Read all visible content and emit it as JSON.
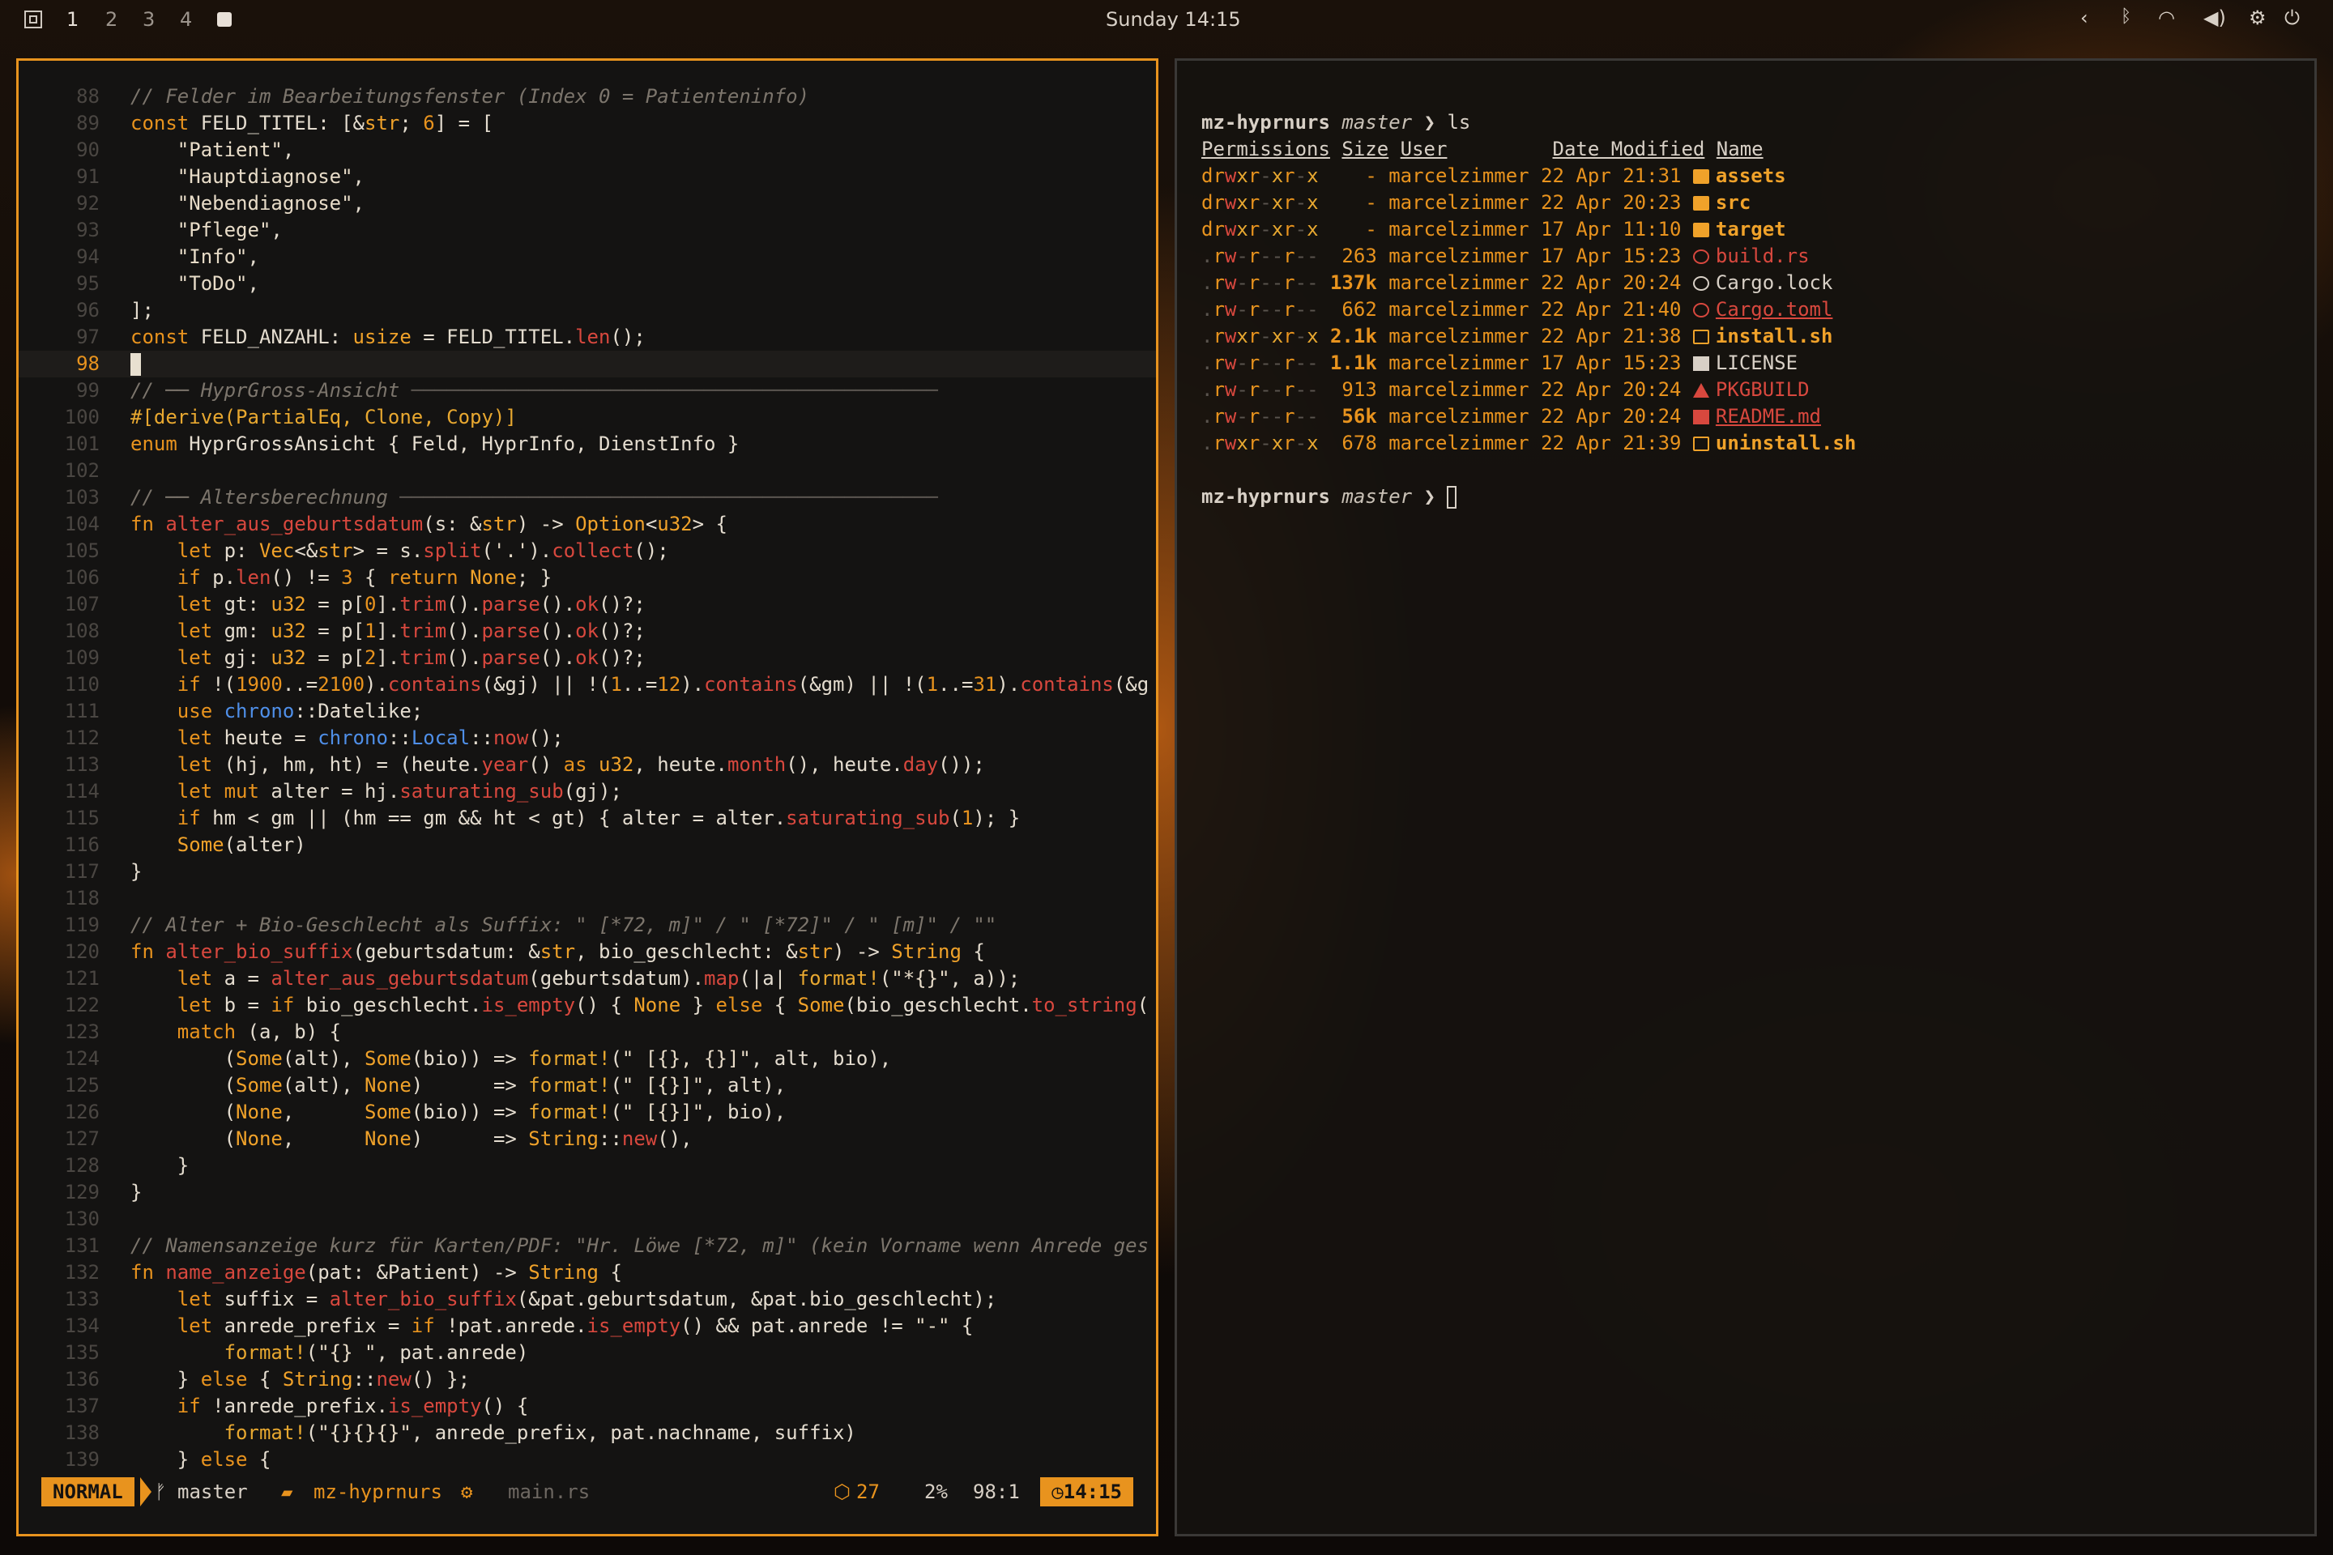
{
  "topbar": {
    "workspaces": [
      "1",
      "2",
      "3",
      "4"
    ],
    "active_workspace": "1",
    "clock": "Sunday 14:15",
    "tray_icons": [
      "chevron-left-icon",
      "bluetooth-icon",
      "wifi-icon",
      "volume-icon",
      "settings-icon",
      "power-icon"
    ]
  },
  "editor": {
    "lines": [
      {
        "n": "88",
        "t": "// Felder im Bearbeitungsfenster (Index 0 = Patienteninfo)"
      },
      {
        "n": "89",
        "t": "const FELD_TITEL: [&str; 6] = ["
      },
      {
        "n": "90",
        "t": "    \"Patient\","
      },
      {
        "n": "91",
        "t": "    \"Hauptdiagnose\","
      },
      {
        "n": "92",
        "t": "    \"Nebendiagnose\","
      },
      {
        "n": "93",
        "t": "    \"Pflege\","
      },
      {
        "n": "94",
        "t": "    \"Info\","
      },
      {
        "n": "95",
        "t": "    \"ToDo\","
      },
      {
        "n": "96",
        "t": "];"
      },
      {
        "n": "97",
        "t": "const FELD_ANZAHL: usize = FELD_TITEL.len();"
      },
      {
        "n": "98",
        "t": ""
      },
      {
        "n": "99",
        "t": "// ── HyprGross-Ansicht ─────────────────────────────────────────────"
      },
      {
        "n": "100",
        "t": "#[derive(PartialEq, Clone, Copy)]"
      },
      {
        "n": "101",
        "t": "enum HyprGrossAnsicht { Feld, HyprInfo, DienstInfo }"
      },
      {
        "n": "102",
        "t": ""
      },
      {
        "n": "103",
        "t": "// ── Altersberechnung ──────────────────────────────────────────────"
      },
      {
        "n": "104",
        "t": "fn alter_aus_geburtsdatum(s: &str) -> Option<u32> {"
      },
      {
        "n": "105",
        "t": "    let p: Vec<&str> = s.split('.').collect();"
      },
      {
        "n": "106",
        "t": "    if p.len() != 3 { return None; }"
      },
      {
        "n": "107",
        "t": "    let gt: u32 = p[0].trim().parse().ok()?;"
      },
      {
        "n": "108",
        "t": "    let gm: u32 = p[1].trim().parse().ok()?;"
      },
      {
        "n": "109",
        "t": "    let gj: u32 = p[2].trim().parse().ok()?;"
      },
      {
        "n": "110",
        "t": "    if !(1900..=2100).contains(&gj) || !(1..=12).contains(&gm) || !(1..=31).contains(&g"
      },
      {
        "n": "111",
        "t": "    use chrono::Datelike;"
      },
      {
        "n": "112",
        "t": "    let heute = chrono::Local::now();"
      },
      {
        "n": "113",
        "t": "    let (hj, hm, ht) = (heute.year() as u32, heute.month(), heute.day());"
      },
      {
        "n": "114",
        "t": "    let mut alter = hj.saturating_sub(gj);"
      },
      {
        "n": "115",
        "t": "    if hm < gm || (hm == gm && ht < gt) { alter = alter.saturating_sub(1); }"
      },
      {
        "n": "116",
        "t": "    Some(alter)"
      },
      {
        "n": "117",
        "t": "}"
      },
      {
        "n": "118",
        "t": ""
      },
      {
        "n": "119",
        "t": "// Alter + Bio-Geschlecht als Suffix: \" [*72, m]\" / \" [*72]\" / \" [m]\" / \"\""
      },
      {
        "n": "120",
        "t": "fn alter_bio_suffix(geburtsdatum: &str, bio_geschlecht: &str) -> String {"
      },
      {
        "n": "121",
        "t": "    let a = alter_aus_geburtsdatum(geburtsdatum).map(|a| format!(\"*{}\", a));"
      },
      {
        "n": "122",
        "t": "    let b = if bio_geschlecht.is_empty() { None } else { Some(bio_geschlecht.to_string("
      },
      {
        "n": "123",
        "t": "    match (a, b) {"
      },
      {
        "n": "124",
        "t": "        (Some(alt), Some(bio)) => format!(\" [{}, {}]\", alt, bio),"
      },
      {
        "n": "125",
        "t": "        (Some(alt), None)      => format!(\" [{}]\", alt),"
      },
      {
        "n": "126",
        "t": "        (None,      Some(bio)) => format!(\" [{}]\", bio),"
      },
      {
        "n": "127",
        "t": "        (None,      None)      => String::new(),"
      },
      {
        "n": "128",
        "t": "    }"
      },
      {
        "n": "129",
        "t": "}"
      },
      {
        "n": "130",
        "t": ""
      },
      {
        "n": "131",
        "t": "// Namensanzeige kurz für Karten/PDF: \"Hr. Löwe [*72, m]\" (kein Vorname wenn Anrede ges"
      },
      {
        "n": "132",
        "t": "fn name_anzeige(pat: &Patient) -> String {"
      },
      {
        "n": "133",
        "t": "    let suffix = alter_bio_suffix(&pat.geburtsdatum, &pat.bio_geschlecht);"
      },
      {
        "n": "134",
        "t": "    let anrede_prefix = if !pat.anrede.is_empty() && pat.anrede != \"-\" {"
      },
      {
        "n": "135",
        "t": "        format!(\"{} \", pat.anrede)"
      },
      {
        "n": "136",
        "t": "    } else { String::new() };"
      },
      {
        "n": "137",
        "t": "    if !anrede_prefix.is_empty() {"
      },
      {
        "n": "138",
        "t": "        format!(\"{}{}{}\", anrede_prefix, pat.nachname, suffix)"
      },
      {
        "n": "139",
        "t": "    } else {"
      }
    ],
    "status": {
      "mode": "NORMAL",
      "branch": "master",
      "project": "mz-hyprnurs",
      "file": "main.rs",
      "diagnostics": "27",
      "percent": "2%",
      "position": "98:1",
      "time": "14:15"
    }
  },
  "terminal": {
    "prompt_host": "mz-hyprnurs",
    "prompt_branch": "master",
    "prompt_symbol": "❯",
    "command": "ls",
    "headers": [
      "Permissions",
      "Size",
      "User",
      "Date Modified",
      "Name"
    ],
    "rows": [
      {
        "perm": "drwxr-xr-x",
        "size": "-",
        "user": "marcelzimmer",
        "date": "22 Apr 21:31",
        "name": "assets",
        "kind": "dir"
      },
      {
        "perm": "drwxr-xr-x",
        "size": "-",
        "user": "marcelzimmer",
        "date": "22 Apr 20:23",
        "name": "src",
        "kind": "dir"
      },
      {
        "perm": "drwxr-xr-x",
        "size": "-",
        "user": "marcelzimmer",
        "date": "17 Apr 11:10",
        "name": "target",
        "kind": "dir"
      },
      {
        "perm": ".rw-r--r--",
        "size": "263",
        "user": "marcelzimmer",
        "date": "17 Apr 15:23",
        "name": "build.rs",
        "kind": "rust"
      },
      {
        "perm": ".rw-r--r--",
        "size": "137k",
        "user": "marcelzimmer",
        "date": "22 Apr 20:24",
        "name": "Cargo.lock",
        "kind": "lock"
      },
      {
        "perm": ".rw-r--r--",
        "size": "662",
        "user": "marcelzimmer",
        "date": "22 Apr 21:40",
        "name": "Cargo.toml",
        "kind": "rust-u"
      },
      {
        "perm": ".rwxr-xr-x",
        "size": "2.1k",
        "user": "marcelzimmer",
        "date": "22 Apr 21:38",
        "name": "install.sh",
        "kind": "sh"
      },
      {
        "perm": ".rw-r--r--",
        "size": "1.1k",
        "user": "marcelzimmer",
        "date": "17 Apr 15:23",
        "name": "LICENSE",
        "kind": "doc"
      },
      {
        "perm": ".rw-r--r--",
        "size": "913",
        "user": "marcelzimmer",
        "date": "22 Apr 20:24",
        "name": "PKGBUILD",
        "kind": "arch"
      },
      {
        "perm": ".rw-r--r--",
        "size": "56k",
        "user": "marcelzimmer",
        "date": "22 Apr 20:24",
        "name": "README.md",
        "kind": "md"
      },
      {
        "perm": ".rwxr-xr-x",
        "size": "678",
        "user": "marcelzimmer",
        "date": "22 Apr 21:39",
        "name": "uninstall.sh",
        "kind": "sh"
      }
    ]
  },
  "colors": {
    "accent": "#e8931e",
    "red": "#d8483e",
    "yellow": "#f0a22a",
    "blue": "#4f8fe8",
    "fg": "#e4dccf",
    "comment": "#7c756c"
  }
}
